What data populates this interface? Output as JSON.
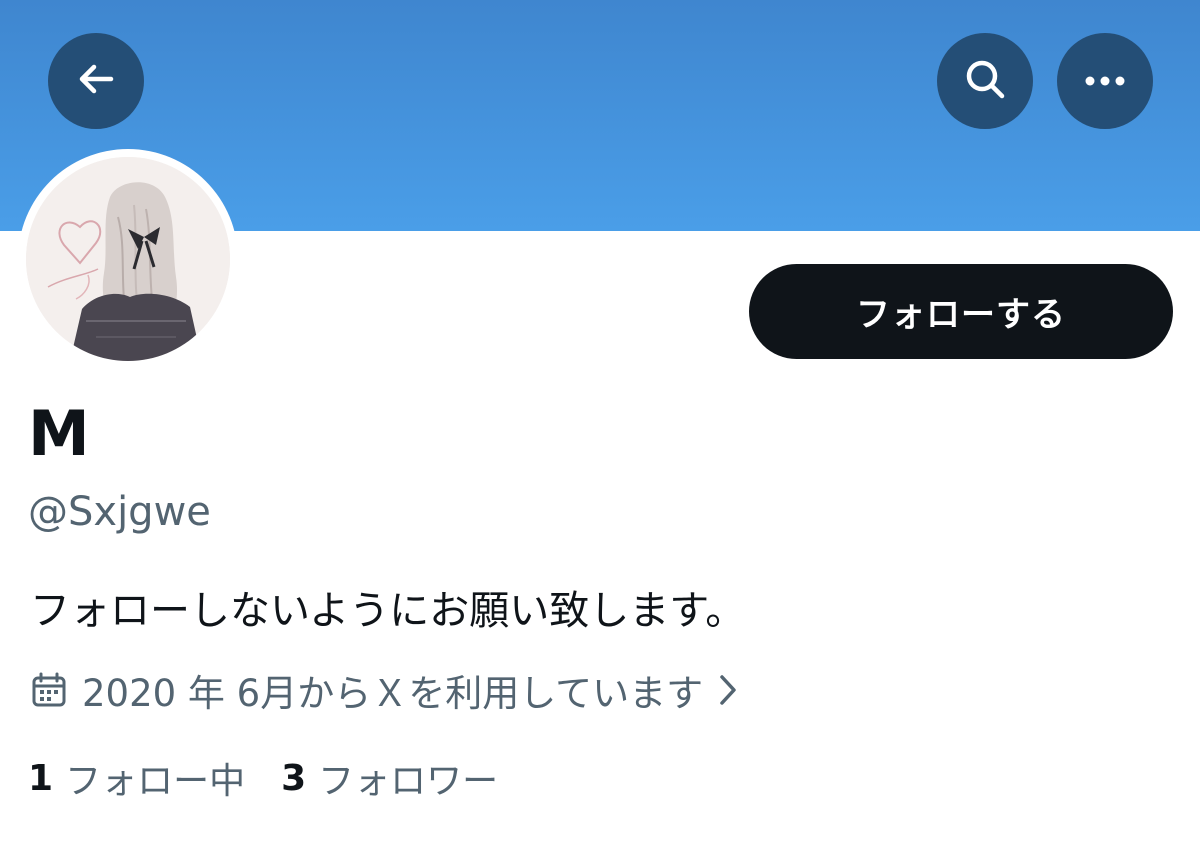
{
  "profile": {
    "display_name": "M",
    "handle": "@Sxjgwe",
    "bio": "フォローしないようにお願い致します。",
    "joined": "2020 年 6月からＸを利用しています",
    "following_count": "1",
    "following_label": "フォロー中",
    "followers_count": "3",
    "followers_label": "フォロワー"
  },
  "actions": {
    "follow_label": "フォローする"
  },
  "icons": {
    "back": "arrow-left-icon",
    "search": "search-icon",
    "more": "more-horizontal-icon",
    "calendar": "calendar-icon",
    "chevron": "chevron-right-icon"
  },
  "colors": {
    "banner_top": "#3f86cf",
    "banner_bottom": "#4a9ee8",
    "header_button": "#244e76",
    "follow_button": "#0f1419",
    "secondary_text": "#536471",
    "primary_text": "#0f1419"
  }
}
